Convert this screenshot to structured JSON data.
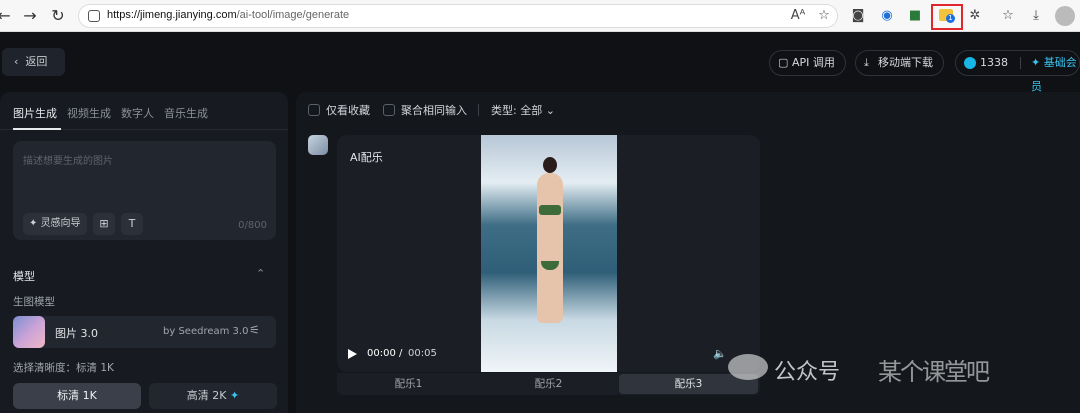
{
  "browser": {
    "url_host": "https://jimeng.jianying.com",
    "url_path": "/ai-tool/image/generate",
    "extension_badge": "1"
  },
  "header": {
    "back_label": "返回",
    "api_label": "API 调用",
    "mobile_download_label": "移动端下载",
    "credits": "1338",
    "membership_label": "基础会员"
  },
  "left": {
    "tabs": [
      "图片生成",
      "视频生成",
      "数字人",
      "音乐生成"
    ],
    "prompt_placeholder": "描述想要生成的图片",
    "inspire_label": "灵感向导",
    "char_counter": "0/800",
    "model_section_title": "模型",
    "model_sub": "生图模型",
    "model_name": "图片 3.0",
    "model_by": "by Seedream 3.0",
    "resolution_label": "选择清晰度：标清 1K",
    "resolution_options": [
      {
        "label": "标清 1K"
      },
      {
        "label": "高清 2K"
      }
    ]
  },
  "right": {
    "filters": {
      "favorites_only": "仅看收藏",
      "merge_same_input": "聚合相同输入",
      "type_label": "类型: 全部"
    },
    "card": {
      "title": "AI配乐",
      "time_current": "00:00",
      "time_sep": "/",
      "time_total": "00:05",
      "music_tabs": [
        "配乐1",
        "配乐2",
        "配乐3"
      ],
      "active_music_tab": 2
    }
  },
  "watermark": {
    "text": "公众号",
    "logo": "某个课堂吧"
  },
  "colors": {
    "page_bg": "#0f1115",
    "panel_bg": "#171a20",
    "accent": "#39c5f0",
    "highlight_box": "#e0272b"
  }
}
